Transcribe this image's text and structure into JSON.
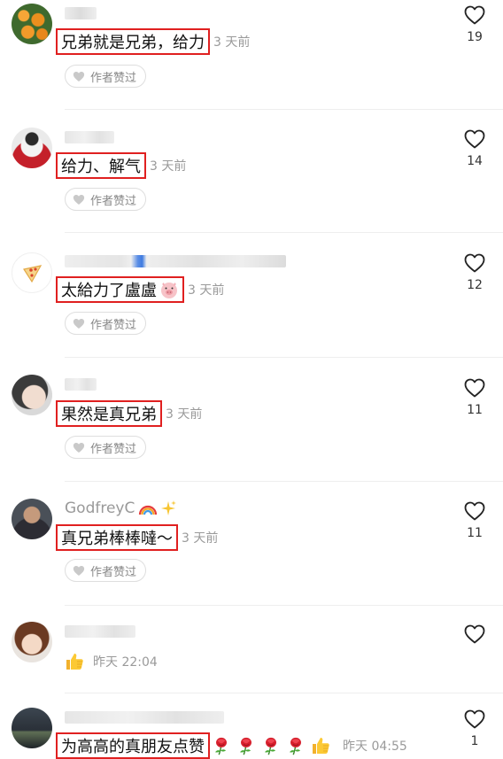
{
  "comments": [
    {
      "username": "",
      "text": "兄弟就是兄弟，给力",
      "time": "3 天前",
      "liked_label": "作者赞过",
      "likes": "19"
    },
    {
      "username": "",
      "text": "给力、解气",
      "time": "3 天前",
      "liked_label": "作者赞过",
      "likes": "14"
    },
    {
      "username": "",
      "text": "太給力了盧盧",
      "time": "3 天前",
      "liked_label": "作者赞过",
      "likes": "12"
    },
    {
      "username": "",
      "text": "果然是真兄弟",
      "time": "3 天前",
      "liked_label": "作者赞过",
      "likes": "11"
    },
    {
      "username": "GodfreyC",
      "text": "真兄弟棒棒噠～",
      "time": "3 天前",
      "liked_label": "作者赞过",
      "likes": "11"
    },
    {
      "username": "",
      "text": "",
      "time": "昨天 22:04",
      "likes": ""
    },
    {
      "username": "",
      "text": "为高高的真朋友点赞",
      "time": "昨天 04:55",
      "likes": "1"
    }
  ],
  "colors": {
    "highlight_border": "#e02020",
    "meta_gray": "#9a9a9a"
  }
}
